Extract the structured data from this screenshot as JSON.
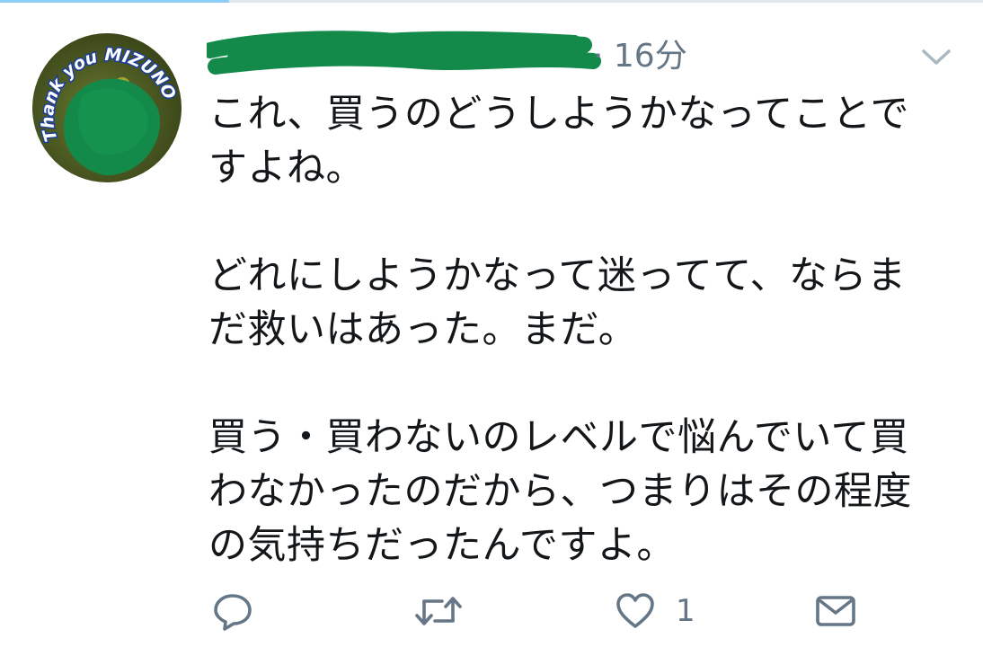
{
  "tweet": {
    "avatar_text": "Thank you MIZUNO",
    "time": "· 16分",
    "paragraphs": [
      [
        "これ、買うのどうしようかなってことで",
        "すよね。"
      ],
      [
        "どれにしようかなって迷ってて、ならま",
        "だ救いはあった。まだ。"
      ],
      [
        "買う・買わないのレベルで悩んでいて買",
        "わなかったのだから、つまりはその程度",
        "の気持ちだったんですよ。"
      ]
    ]
  },
  "actions": {
    "reply_icon": "reply-icon",
    "retweet_icon": "retweet-icon",
    "like_icon": "heart-icon",
    "like_count": "1",
    "dm_icon": "envelope-icon"
  },
  "colors": {
    "text": "#14171a",
    "muted": "#657786",
    "redaction": "#138a4a",
    "avatar_ring_text": "#1d3f9a"
  }
}
